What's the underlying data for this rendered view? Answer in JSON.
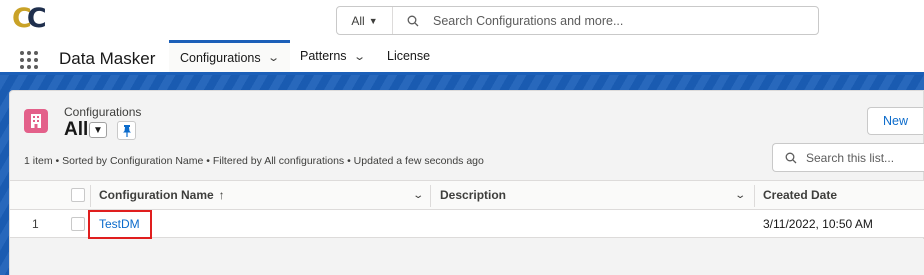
{
  "global_header": {
    "logo_text": "CC",
    "search": {
      "scope_label": "All",
      "placeholder": "Search Configurations and more..."
    }
  },
  "nav": {
    "app_name": "Data Masker",
    "tabs": [
      {
        "label": "Configurations",
        "active": true,
        "has_menu": true
      },
      {
        "label": "Patterns",
        "active": false,
        "has_menu": true
      },
      {
        "label": "License",
        "active": false,
        "has_menu": false
      }
    ]
  },
  "list_view": {
    "object_label": "Configurations",
    "view_name": "All",
    "new_button": "New",
    "info": "1 item • Sorted by Configuration Name • Filtered by All configurations • Updated a few seconds ago",
    "search_placeholder": "Search this list...",
    "columns": [
      {
        "label": "Configuration Name",
        "sort_indicator": "↑"
      },
      {
        "label": "Description"
      },
      {
        "label": "Created Date"
      }
    ],
    "rows": [
      {
        "num": "1",
        "name": "TestDM",
        "description": "",
        "created_date": "3/11/2022, 10:50 AM"
      }
    ]
  },
  "colors": {
    "brand_blue": "#1b5fb8",
    "link": "#0b6bcb",
    "object_icon": "#e3608a",
    "highlight_border": "#e01e1e",
    "logo_gold": "#c9a227",
    "logo_navy": "#1f2f4d"
  },
  "icons": [
    "app-logo",
    "chevron-down-icon",
    "search-icon",
    "waffle-icon",
    "object-icon",
    "pin-icon",
    "checkbox"
  ]
}
